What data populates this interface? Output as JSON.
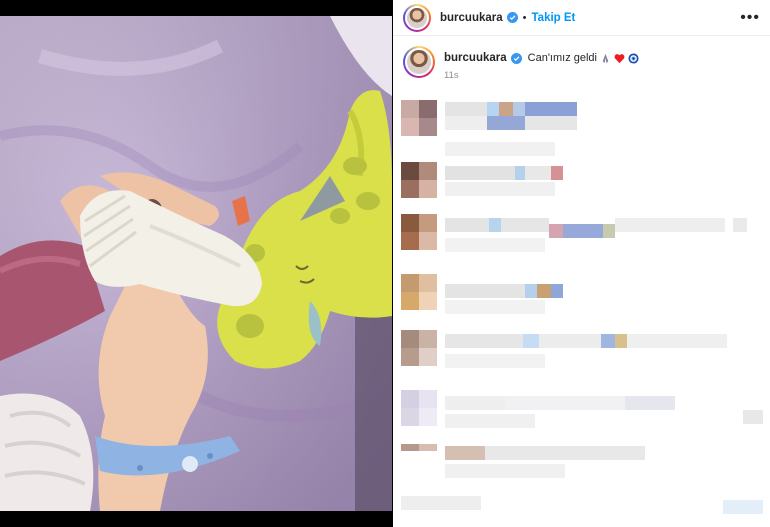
{
  "post": {
    "username": "burcuukara",
    "follow_label": "Takip Et",
    "separator": "•",
    "more_label": "•••",
    "caption": {
      "username": "burcuukara",
      "text": "Can'ımız geldi",
      "time": "11s"
    }
  },
  "colors": {
    "accent": "#0095f6",
    "verified": "#3897f0",
    "heart": "#ed1c24",
    "evil_eye": "#1d4fb8"
  },
  "icons": [
    "verified-badge-icon",
    "praying-hands-emoji",
    "red-heart-emoji",
    "evil-eye-emoji",
    "more-options-icon"
  ]
}
